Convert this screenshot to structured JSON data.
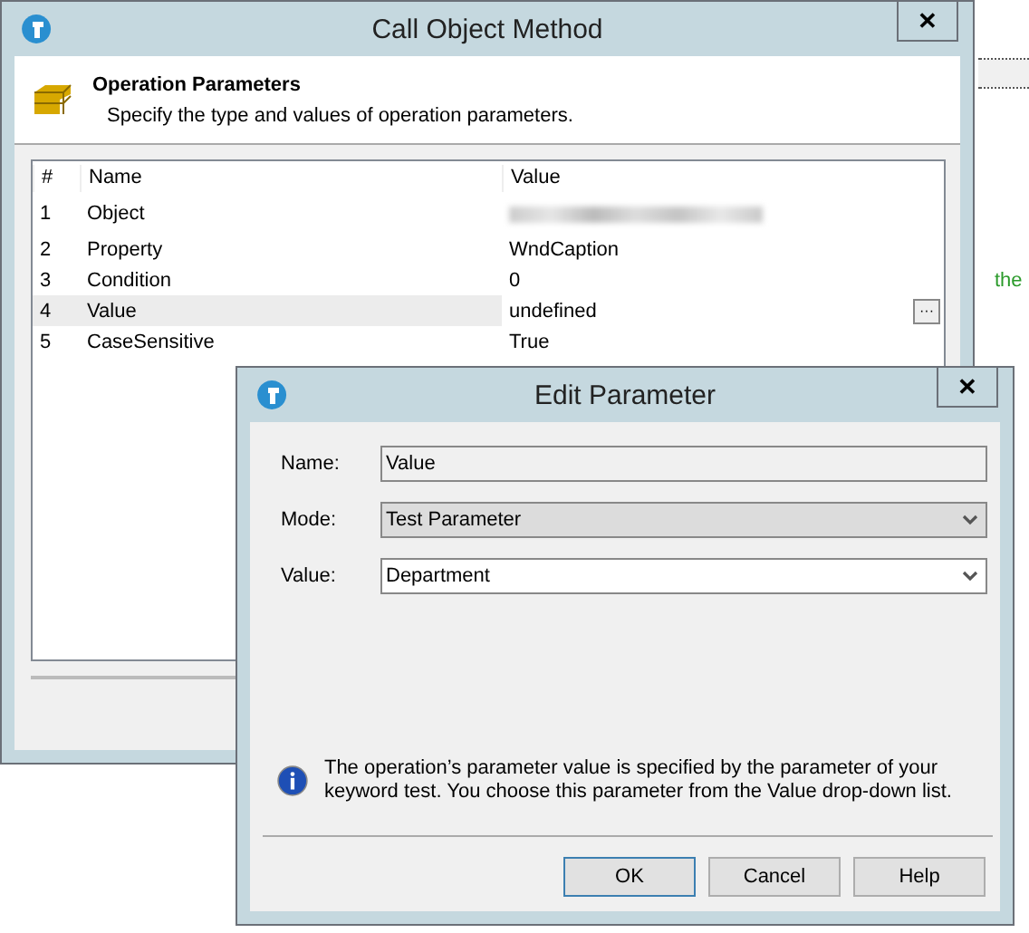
{
  "background": {
    "text": "the"
  },
  "main_window": {
    "title": "Call Object Method",
    "close": "✕",
    "header": {
      "title": "Operation Parameters",
      "subtitle": "Specify the type and values of operation parameters."
    },
    "table": {
      "columns": [
        "#",
        "Name",
        "Value"
      ],
      "rows": [
        {
          "index": "1",
          "name": "Object",
          "selected": false
        },
        {
          "index": "2",
          "name": "Property",
          "value": "WndCaption",
          "selected": false
        },
        {
          "index": "3",
          "name": "Condition",
          "value": "0",
          "selected": false
        },
        {
          "index": "4",
          "name": "Value",
          "value": "undefined",
          "selected": true,
          "ellipsis": "···"
        },
        {
          "index": "5",
          "name": "CaseSensitive",
          "value": "True",
          "selected": false
        }
      ]
    }
  },
  "edit_dialog": {
    "title": "Edit Parameter",
    "close": "✕",
    "fields": [
      {
        "label": "Name:",
        "value": "Value",
        "kind": "text"
      },
      {
        "label": "Mode:",
        "value": "Test Parameter",
        "kind": "combo-disabled"
      },
      {
        "label": "Value:",
        "value": "Department",
        "kind": "combo"
      }
    ],
    "info": "The operation’s parameter value is specified by the parameter of your keyword test. You choose this parameter from the Value drop-down list.",
    "buttons": [
      {
        "label": "OK",
        "default": true
      },
      {
        "label": "Cancel",
        "default": false
      },
      {
        "label": "Help",
        "default": false
      }
    ]
  }
}
